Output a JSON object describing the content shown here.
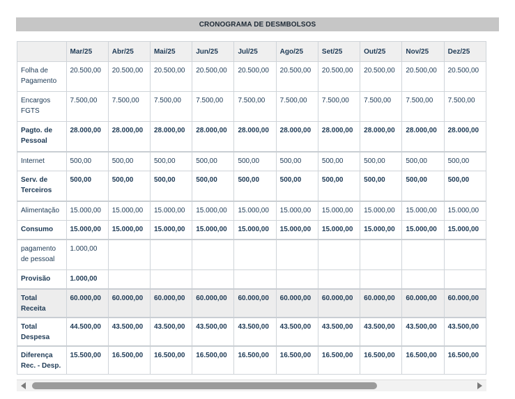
{
  "title": "CRONOGRAMA DE DESMBOLSOS",
  "months": [
    "Mar/25",
    "Abr/25",
    "Mai/25",
    "Jun/25",
    "Jul/25",
    "Ago/25",
    "Set/25",
    "Out/25",
    "Nov/25",
    "Dez/25"
  ],
  "rows": [
    {
      "label": "Folha de Pagamento",
      "values": [
        "20.500,00",
        "20.500,00",
        "20.500,00",
        "20.500,00",
        "20.500,00",
        "20.500,00",
        "20.500,00",
        "20.500,00",
        "20.500,00",
        "20.500,00"
      ]
    },
    {
      "label": "Encargos FGTS",
      "values": [
        "7.500,00",
        "7.500,00",
        "7.500,00",
        "7.500,00",
        "7.500,00",
        "7.500,00",
        "7.500,00",
        "7.500,00",
        "7.500,00",
        "7.500,00"
      ]
    },
    {
      "label": "Pagto. de Pessoal",
      "values": [
        "28.000,00",
        "28.000,00",
        "28.000,00",
        "28.000,00",
        "28.000,00",
        "28.000,00",
        "28.000,00",
        "28.000,00",
        "28.000,00",
        "28.000,00"
      ]
    },
    {
      "label": "Internet",
      "values": [
        "500,00",
        "500,00",
        "500,00",
        "500,00",
        "500,00",
        "500,00",
        "500,00",
        "500,00",
        "500,00",
        "500,00"
      ]
    },
    {
      "label": "Serv. de Terceiros",
      "values": [
        "500,00",
        "500,00",
        "500,00",
        "500,00",
        "500,00",
        "500,00",
        "500,00",
        "500,00",
        "500,00",
        "500,00"
      ]
    },
    {
      "label": "Alimentação",
      "values": [
        "15.000,00",
        "15.000,00",
        "15.000,00",
        "15.000,00",
        "15.000,00",
        "15.000,00",
        "15.000,00",
        "15.000,00",
        "15.000,00",
        "15.000,00"
      ]
    },
    {
      "label": "Consumo",
      "values": [
        "15.000,00",
        "15.000,00",
        "15.000,00",
        "15.000,00",
        "15.000,00",
        "15.000,00",
        "15.000,00",
        "15.000,00",
        "15.000,00",
        "15.000,00"
      ]
    },
    {
      "label": "pagamento de pessoal",
      "values": [
        "1.000,00",
        "",
        "",
        "",
        "",
        "",
        "",
        "",
        "",
        ""
      ]
    },
    {
      "label": "Provisão",
      "values": [
        "1.000,00",
        "",
        "",
        "",
        "",
        "",
        "",
        "",
        "",
        ""
      ]
    },
    {
      "label": "Total Receita",
      "values": [
        "60.000,00",
        "60.000,00",
        "60.000,00",
        "60.000,00",
        "60.000,00",
        "60.000,00",
        "60.000,00",
        "60.000,00",
        "60.000,00",
        "60.000,00"
      ]
    },
    {
      "label": "Total Despesa",
      "values": [
        "44.500,00",
        "43.500,00",
        "43.500,00",
        "43.500,00",
        "43.500,00",
        "43.500,00",
        "43.500,00",
        "43.500,00",
        "43.500,00",
        "43.500,00"
      ]
    },
    {
      "label": "Diferença Rec. - Desp.",
      "values": [
        "15.500,00",
        "16.500,00",
        "16.500,00",
        "16.500,00",
        "16.500,00",
        "16.500,00",
        "16.500,00",
        "16.500,00",
        "16.500,00",
        "16.500,00"
      ]
    }
  ],
  "colors": {
    "header_bar": "#c6c6c6",
    "text": "#1e3a55",
    "header_row": "#efefef",
    "total_row": "#ededed"
  }
}
